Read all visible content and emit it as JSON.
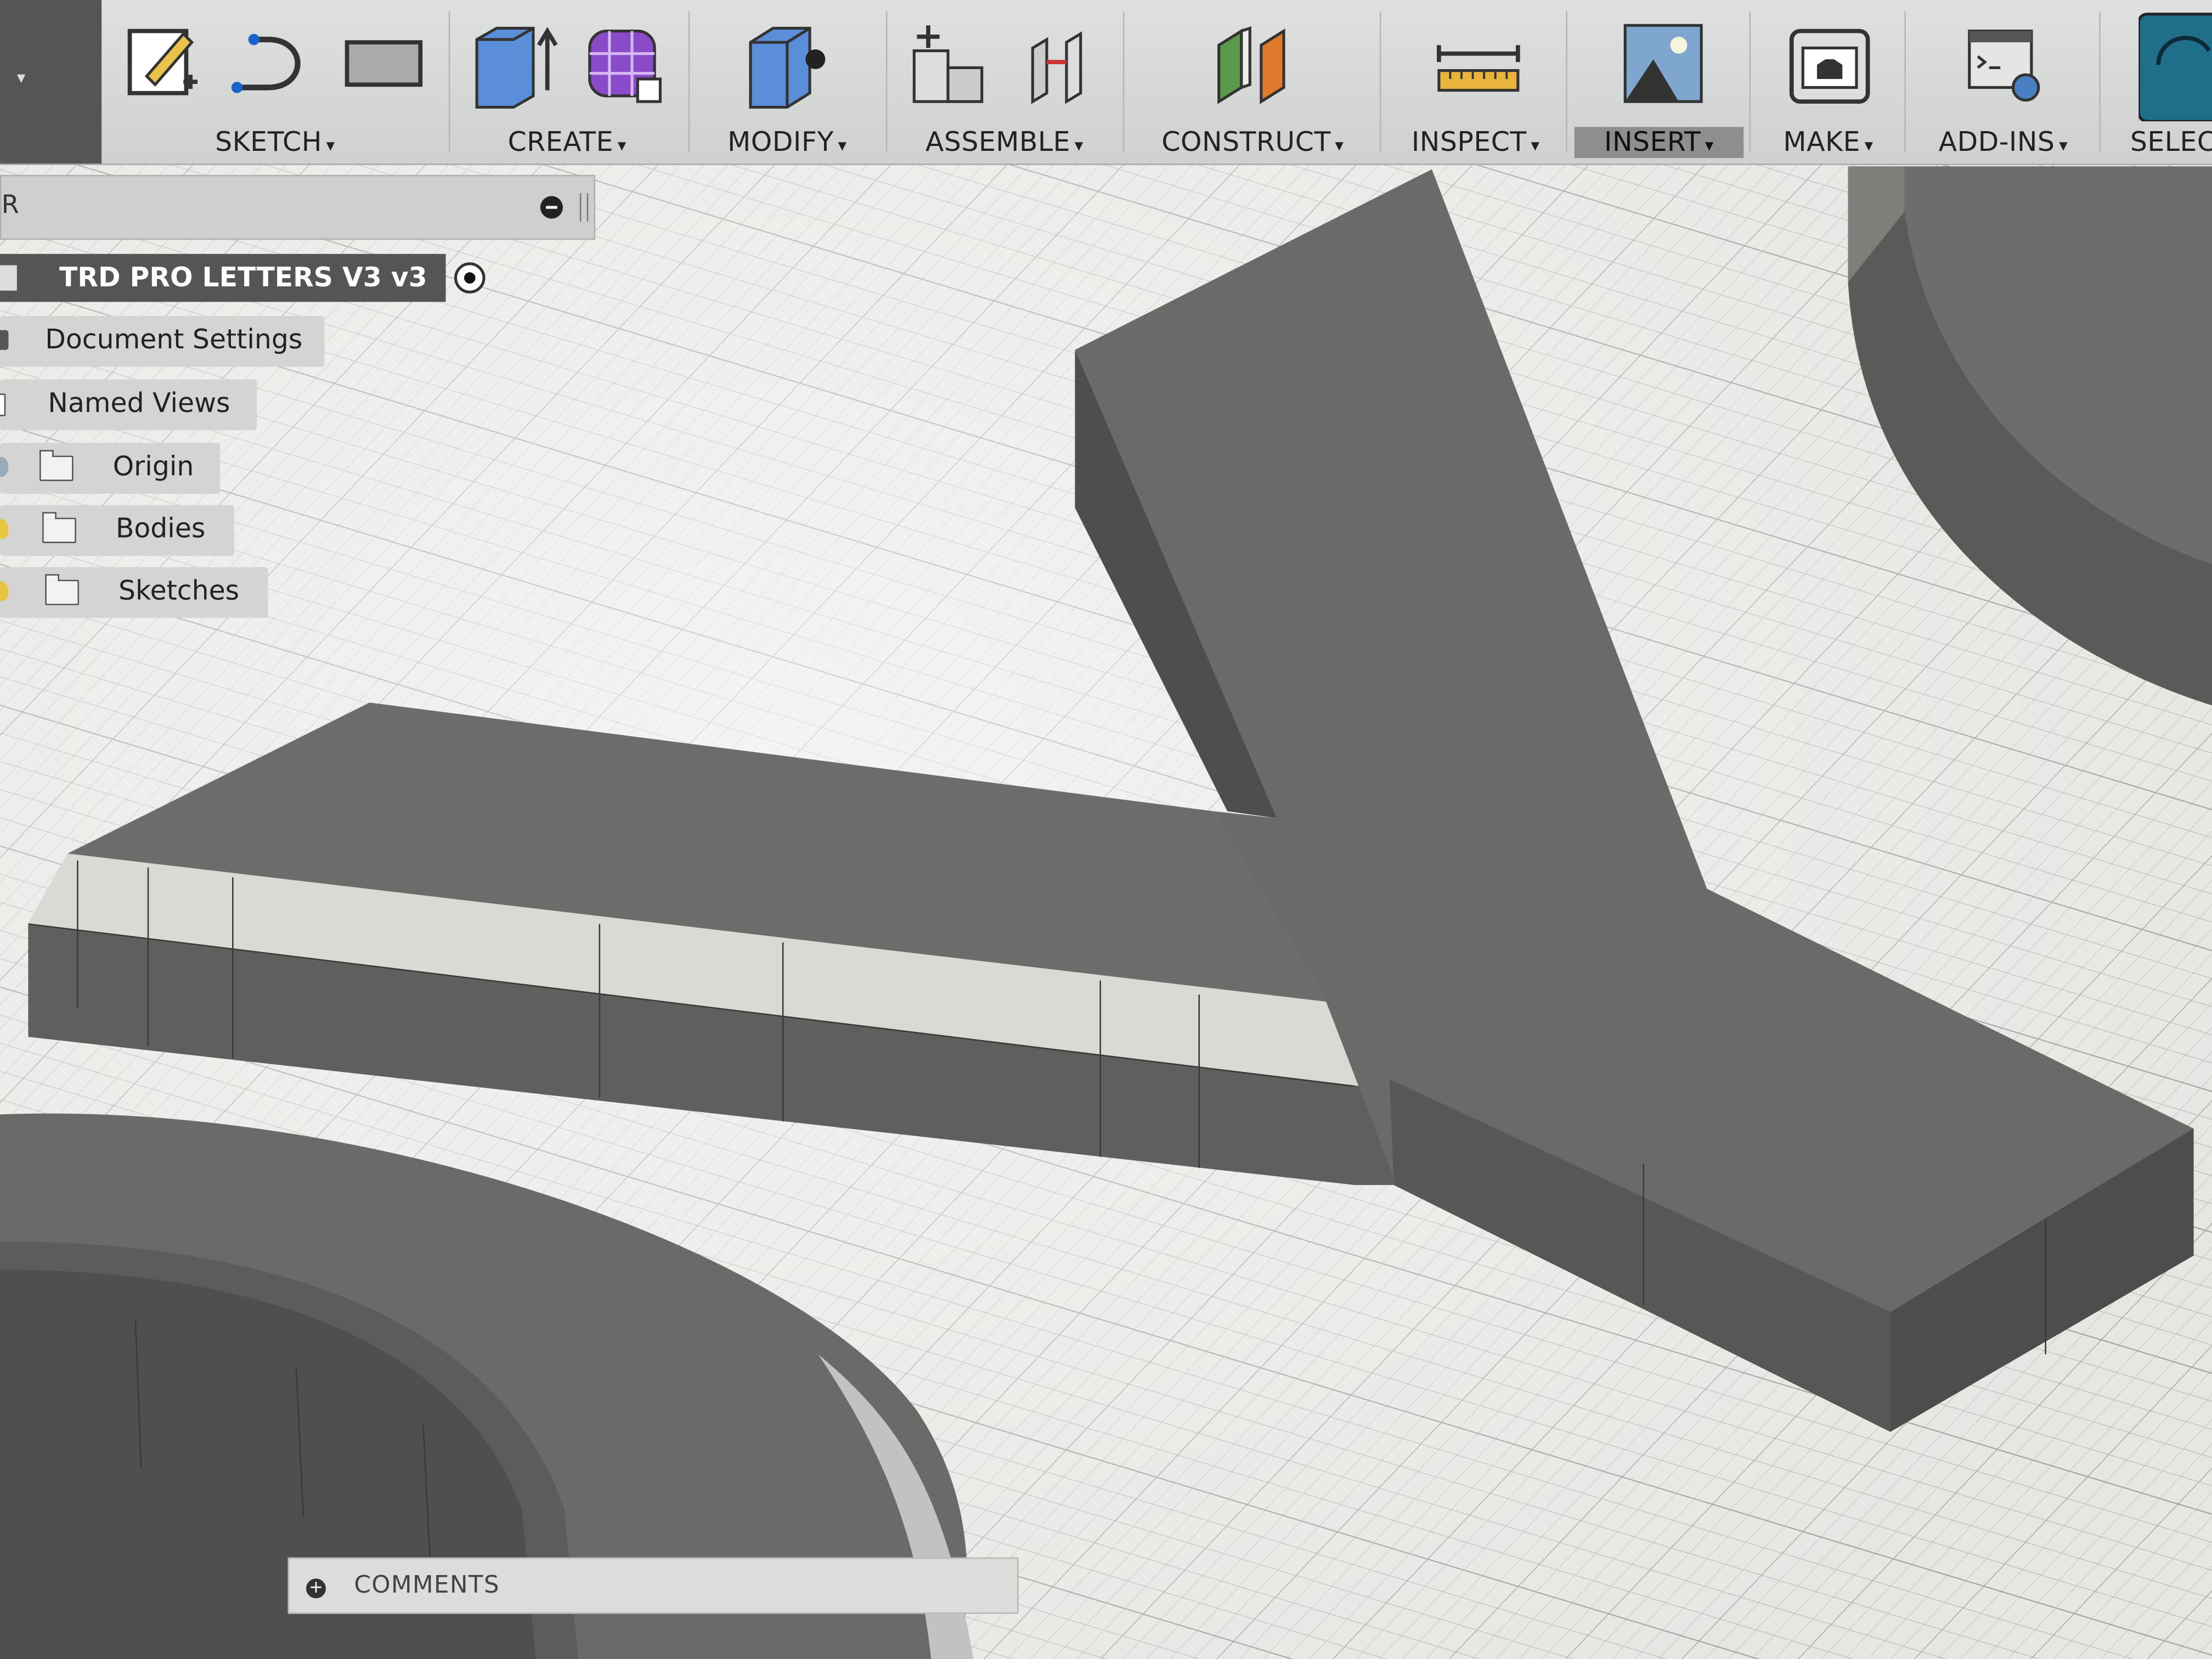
{
  "toolbar": {
    "groups": [
      {
        "label": "SKETCH"
      },
      {
        "label": "CREATE"
      },
      {
        "label": "MODIFY"
      },
      {
        "label": "ASSEMBLE"
      },
      {
        "label": "CONSTRUCT"
      },
      {
        "label": "INSPECT"
      },
      {
        "label": "INSERT"
      },
      {
        "label": "MAKE"
      },
      {
        "label": "ADD-INS"
      },
      {
        "label": "SELEC"
      }
    ],
    "caret": "▾"
  },
  "browser": {
    "header_label": "R",
    "root": "TRD PRO LETTERS V3 v3",
    "items": [
      {
        "label": "Document Settings"
      },
      {
        "label": "Named Views"
      },
      {
        "label": "Origin"
      },
      {
        "label": "Bodies"
      },
      {
        "label": "Sketches"
      }
    ]
  },
  "comments": {
    "label": "COMMENTS"
  },
  "colors": {
    "accent_select": "#1f6f8b",
    "body_top": "#6e6e6c",
    "body_side": "#5b5b59"
  }
}
